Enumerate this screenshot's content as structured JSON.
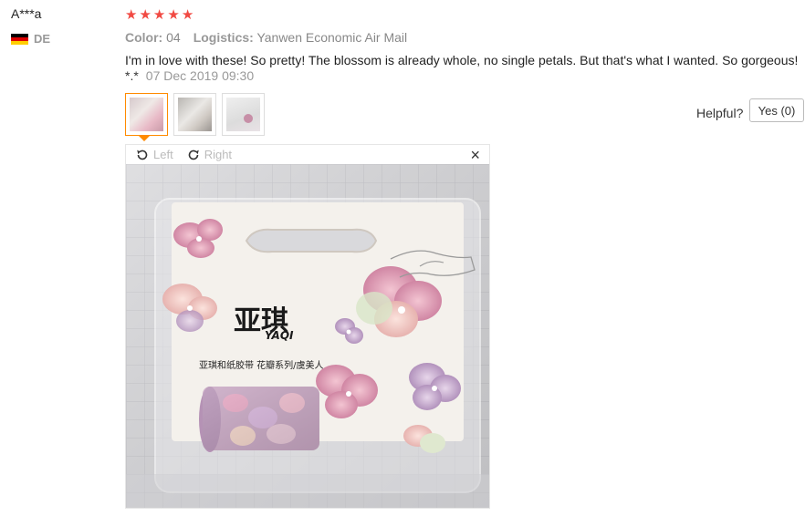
{
  "reviewer": {
    "name": "A***a",
    "country": "DE",
    "flag_colors": [
      "#000000",
      "#dd0000",
      "#ffce00"
    ]
  },
  "rating": {
    "stars": 5,
    "star_color": "#f14a43"
  },
  "meta": {
    "color_label": "Color:",
    "color_value": "04",
    "logistics_label": "Logistics:",
    "logistics_value": "Yanwen Economic Air Mail"
  },
  "review": {
    "text": "I'm in love with these! So pretty! The blossom is already whole, no single petals. But that's what I wanted. So gorgeous!",
    "prefix": "*.*",
    "date": "07 Dec 2019 09:30"
  },
  "thumbnails": [
    {
      "name": "photo-1",
      "active": true
    },
    {
      "name": "photo-2",
      "active": false
    },
    {
      "name": "photo-3",
      "active": false
    }
  ],
  "helpful": {
    "label": "Helpful?",
    "yes_label": "Yes (0)"
  },
  "viewer": {
    "rotate_left_label": "Left",
    "rotate_right_label": "Right",
    "close_glyph": "×",
    "brand_logo": "亚琪",
    "brand_latin": "YAQI",
    "product_caption": "亚琪和纸胶带 花瓣系列/虞美人",
    "accent_color": "#ff8a00"
  }
}
